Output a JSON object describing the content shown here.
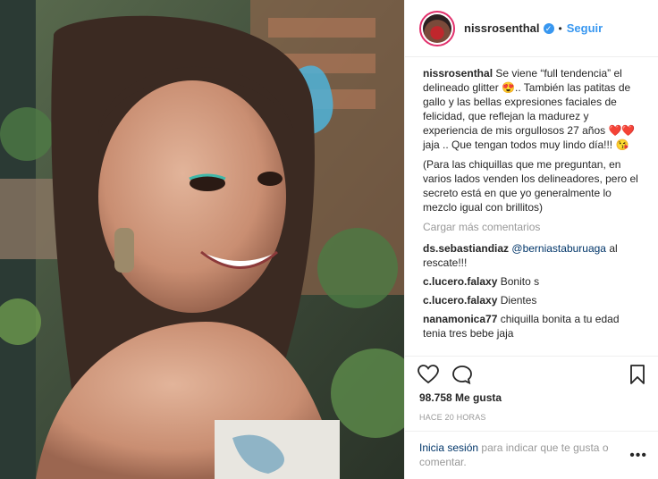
{
  "post": {
    "username": "nissrosenthal",
    "follow_label": "Seguir",
    "dot": "•",
    "caption": {
      "username": "nissrosenthal",
      "text": "Se viene “full tendencia” el delineado glitter 😍.. También las patitas de gallo y las bellas expresiones faciales de felicidad, que reflejan la madurez y experiencia de mis orgullosos 27 años ❤️❤️ jaja .. Que tengan todos muy lindo día!!! 😘",
      "text2": "(Para las chiquillas que me preguntan, en varios lados venden los delineadores, pero el secreto está en que yo generalmente lo mezclo igual con brillitos)"
    },
    "load_more": "Cargar más comentarios",
    "comments": [
      {
        "user": "ds.sebastiandiaz",
        "mention": "@berniastaburuaga",
        "text": "al rescate!!!"
      },
      {
        "user": "c.lucero.falaxy",
        "text": "Bonito s"
      },
      {
        "user": "c.lucero.falaxy",
        "text": "Dientes"
      },
      {
        "user": "nanamonica77",
        "text": "chiquilla bonita a tu edad tenia tres bebe jaja"
      }
    ],
    "likes": "98.758 Me gusta",
    "time": "HACE 20 HORAS",
    "login_link": "Inicia sesión",
    "login_rest": "para indicar que te gusta o comentar.",
    "more": "•••"
  }
}
